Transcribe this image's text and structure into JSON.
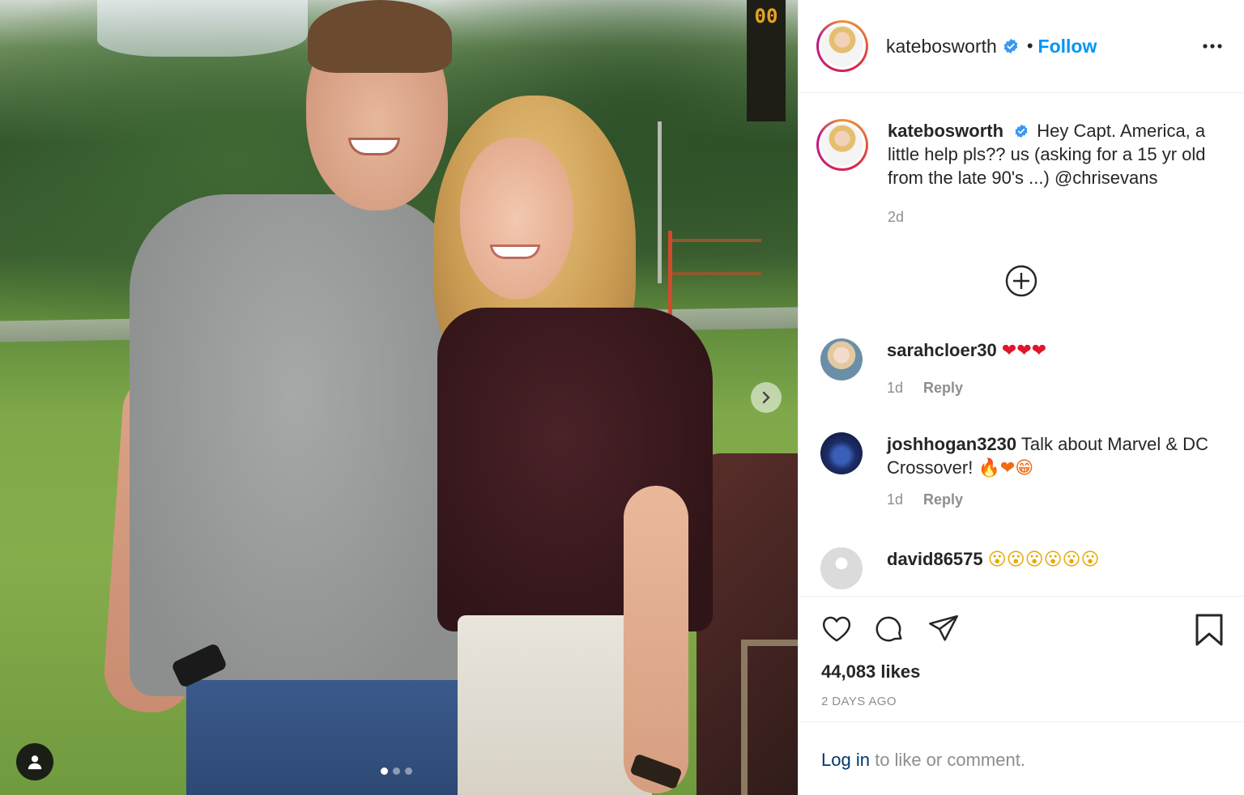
{
  "post": {
    "author": "katebosworth",
    "follow_label": "Follow",
    "separator": "•",
    "caption_text": "Hey Capt. America, a little help pls?? us (asking for a 15 yr old from the late 90's ...) @chrisevans",
    "caption_time": "2d",
    "likes": "44,083 likes",
    "date": "2 DAYS AGO",
    "carousel": {
      "total": 3,
      "active": 1
    },
    "photo_sign_text": "00"
  },
  "comments": [
    {
      "user": "sarahcloer30",
      "text": "",
      "emoji": "❤❤❤",
      "time": "1d",
      "reply": "Reply"
    },
    {
      "user": "joshhogan3230",
      "text": "Talk about Marvel & DC Crossover!",
      "emoji": "🔥❤😁",
      "time": "1d",
      "reply": "Reply"
    },
    {
      "user": "david86575",
      "text": "",
      "emoji": "😮😮😮😮😮😮"
    }
  ],
  "login": {
    "link": "Log in",
    "rest": "to like or comment."
  },
  "icons": {
    "more": "more-options-icon",
    "verified": "verified-badge-icon",
    "load_more": "plus-circle-icon",
    "like": "heart-icon",
    "comment": "comment-icon",
    "share": "paper-plane-icon",
    "save": "bookmark-icon",
    "tag": "user-tag-icon",
    "next": "chevron-right-icon"
  },
  "colors": {
    "follow": "#0095f6",
    "link": "#00376b",
    "muted": "#8e8e8e",
    "text": "#262626"
  }
}
